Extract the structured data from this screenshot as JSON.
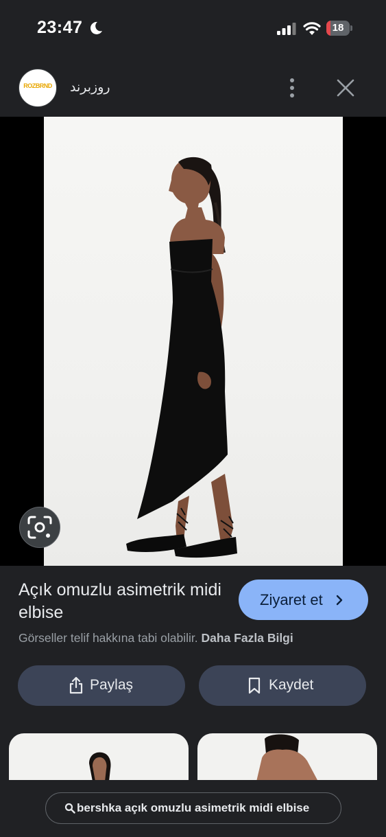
{
  "status_bar": {
    "time": "23:47",
    "battery_level": "18",
    "battery_fraction": 0.18,
    "icons": [
      "moon-icon",
      "signal-icon",
      "wifi-icon",
      "battery-icon"
    ]
  },
  "header": {
    "site_name": "روزبرند",
    "logo_text": "ROZBRND",
    "icons": [
      "more-vertical-icon",
      "close-icon"
    ]
  },
  "image": {
    "subject": "product-photo",
    "lens_icon": "lens-search-icon"
  },
  "product": {
    "title": "Açık omuzlu asimetrik midi elbise",
    "visit_label": "Ziyaret et",
    "copyright_text": "Görseller telif hakkına tabi olabilir.",
    "copyright_link": "Daha Fazla Bilgi"
  },
  "actions": {
    "share_label": "Paylaş",
    "save_label": "Kaydet"
  },
  "bottom_search": {
    "query": "bershka açık omuzlu asimetrik midi elbise"
  },
  "colors": {
    "background": "#202124",
    "accent": "#8ab4f8",
    "action_button": "#3c4457",
    "battery_low": "#e5484d"
  }
}
